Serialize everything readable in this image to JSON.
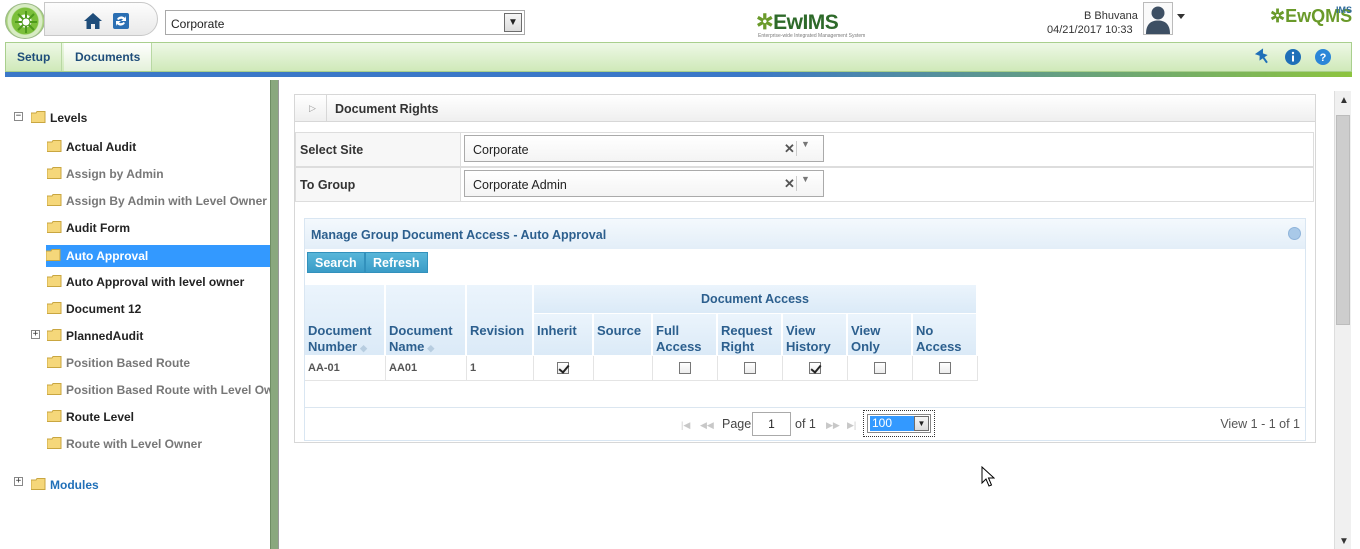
{
  "header": {
    "site_selected": "Corporate",
    "brand": "EwIMS",
    "brand_prefix": "✲",
    "brand_tagline": "Enterprise-wide Integrated Management System",
    "user_name": "B Bhuvana",
    "datetime": "04/21/2017 10:33",
    "brand2": "EwQMS",
    "brand2_small": "IMS"
  },
  "menu": {
    "items": [
      "Setup",
      "Documents"
    ],
    "active": "Documents"
  },
  "tree": {
    "root_label": "Levels",
    "modules_label": "Modules",
    "items": [
      {
        "label": "Actual Audit",
        "style": "normal"
      },
      {
        "label": "Assign by Admin",
        "style": "dim"
      },
      {
        "label": "Assign By Admin with Level Owner",
        "style": "dim"
      },
      {
        "label": "Audit Form",
        "style": "normal"
      },
      {
        "label": "Auto Approval",
        "style": "selected"
      },
      {
        "label": "Auto Approval with level owner",
        "style": "normal"
      },
      {
        "label": "Document 12",
        "style": "normal"
      },
      {
        "label": "PlannedAudit",
        "style": "normal"
      },
      {
        "label": "Position Based Route",
        "style": "dim"
      },
      {
        "label": "Position Based Route with Level Owner",
        "style": "dim"
      },
      {
        "label": "Route Level",
        "style": "normal"
      },
      {
        "label": "Route with Level Owner",
        "style": "dim"
      }
    ]
  },
  "panel": {
    "title": "Document Rights",
    "select_site_label": "Select Site",
    "select_site_value": "Corporate",
    "to_group_label": "To Group",
    "to_group_value": "Corporate Admin"
  },
  "grid": {
    "caption": "Manage Group Document Access - Auto Approval",
    "search_label": "Search",
    "refresh_label": "Refresh",
    "group_header": "Document Access",
    "columns": [
      "Document Number",
      "Document Name",
      "Revision",
      "Inherit",
      "Source",
      "Full Access",
      "Request Right",
      "View History",
      "View Only",
      "No Access"
    ],
    "rows": [
      {
        "doc_number": "AA-01",
        "doc_name": "AA01",
        "revision": "1",
        "inherit": true,
        "source": "",
        "full_access": false,
        "request_right": false,
        "view_history": true,
        "view_only": false,
        "no_access": false
      }
    ],
    "pager": {
      "page_label": "Page",
      "page": "1",
      "of_label": "of 1",
      "rows_per_page": "100",
      "view_text": "View 1 - 1 of 1"
    }
  }
}
